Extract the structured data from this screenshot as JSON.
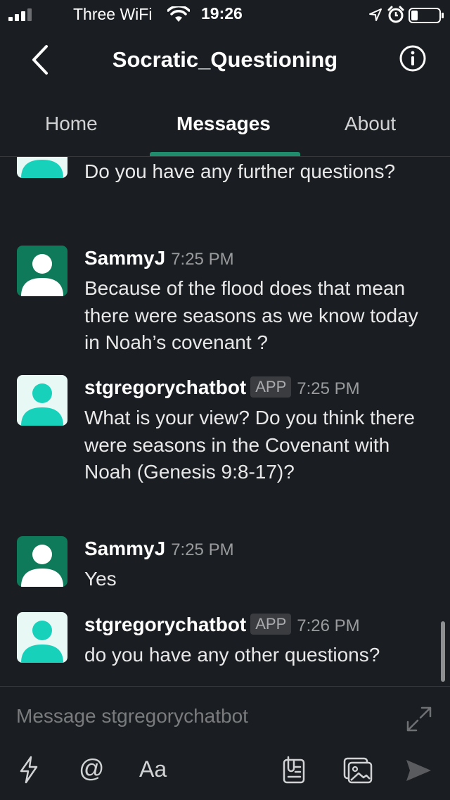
{
  "status_bar": {
    "carrier": "Three WiFi",
    "time": "19:26"
  },
  "header": {
    "title": "Socratic_Questioning",
    "back_icon": "chevron-left-icon",
    "info_icon": "info-icon"
  },
  "tabs": [
    {
      "label": "Home",
      "active": false
    },
    {
      "label": "Messages",
      "active": true
    },
    {
      "label": "About",
      "active": false
    }
  ],
  "messages": [
    {
      "author": "",
      "app": "",
      "time": "",
      "text": "Do you have any further questions?",
      "avatar": "bot"
    },
    {
      "author": "SammyJ",
      "app": "",
      "time": "7:25 PM",
      "text": "Because of the flood does that mean there were seasons as we know today in Noah’s covenant ?",
      "avatar": "user"
    },
    {
      "author": "stgregorychatbot",
      "app": "APP",
      "time": "7:25 PM",
      "text": "What is your view? Do you think there were seasons in the Covenant with Noah (Genesis 9:8-17)?",
      "avatar": "bot"
    },
    {
      "author": "SammyJ",
      "app": "",
      "time": "7:25 PM",
      "text": "Yes",
      "avatar": "user"
    },
    {
      "author": "stgregorychatbot",
      "app": "APP",
      "time": "7:26 PM",
      "text": "do you have any other questions?",
      "avatar": "bot"
    }
  ],
  "composer": {
    "placeholder": "Message stgregorychatbot",
    "at_label": "@",
    "format_label": "Aa"
  },
  "colors": {
    "background": "#1a1d21",
    "accent": "#1f8c6b",
    "bot_avatar_person": "#18d1bb",
    "user_avatar_bg": "#0f7a5a"
  }
}
